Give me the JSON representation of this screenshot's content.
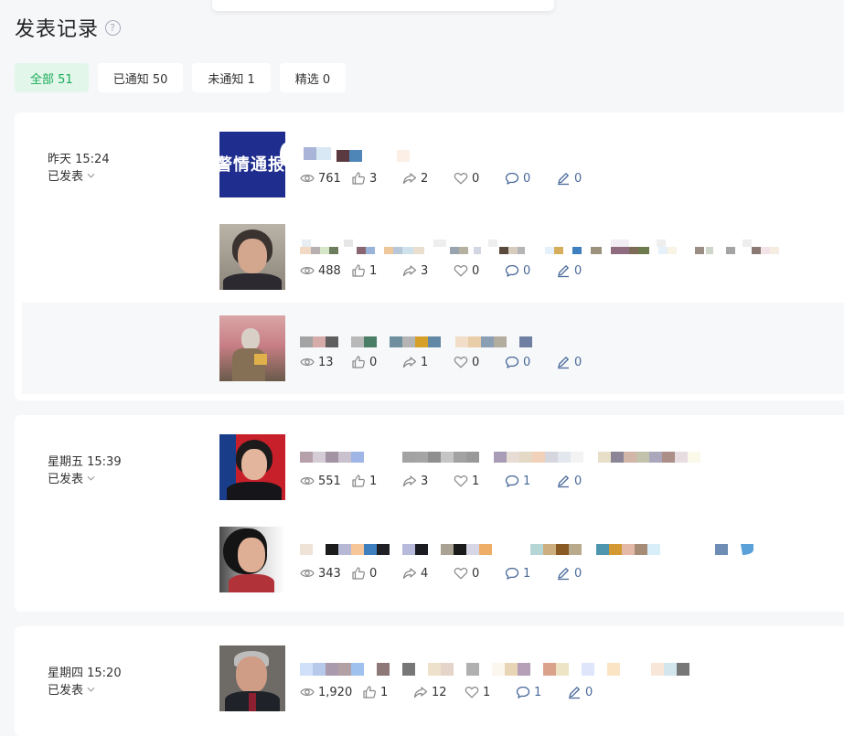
{
  "title": "发表记录",
  "help_icon": "question-circle-icon",
  "tabs": [
    {
      "label": "全部 51",
      "active": true
    },
    {
      "label": "已通知 50",
      "active": false
    },
    {
      "label": "未通知 1",
      "active": false
    },
    {
      "label": "精选 0",
      "active": false
    }
  ],
  "groups": [
    {
      "date": "昨天 15:24",
      "status": "已发表",
      "posts": [
        {
          "thumb_text": "警情通报",
          "views": "761",
          "likes": "3",
          "shares": "2",
          "favs": "0",
          "comments": "0",
          "edits": "0"
        },
        {
          "views": "488",
          "likes": "1",
          "shares": "3",
          "favs": "0",
          "comments": "0",
          "edits": "0"
        },
        {
          "views": "13",
          "likes": "0",
          "shares": "1",
          "favs": "0",
          "comments": "0",
          "edits": "0"
        }
      ]
    },
    {
      "date": "星期五 15:39",
      "status": "已发表",
      "posts": [
        {
          "views": "551",
          "likes": "1",
          "shares": "3",
          "favs": "1",
          "comments": "1",
          "edits": "0"
        },
        {
          "views": "343",
          "likes": "0",
          "shares": "4",
          "favs": "0",
          "comments": "1",
          "edits": "0"
        }
      ]
    },
    {
      "date": "星期四 15:20",
      "status": "已发表",
      "posts": [
        {
          "views": "1,920",
          "likes": "1",
          "shares": "12",
          "favs": "1",
          "comments": "1",
          "edits": "0"
        }
      ]
    }
  ],
  "colors": {
    "accent": "#1aad5a",
    "tab_active_bg": "#e2f6ea",
    "link_blue": "#4a6a9a"
  },
  "icons": [
    "eye-icon",
    "thumbs-up-icon",
    "share-icon",
    "heart-icon",
    "comment-icon",
    "pen-icon",
    "chevron-down-icon"
  ]
}
